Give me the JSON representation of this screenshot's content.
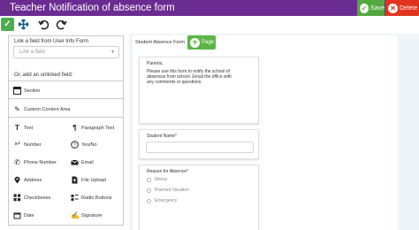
{
  "titlebar": {
    "title": "Teacher Notification of absence form"
  },
  "actions": {
    "save_label": "Save",
    "delete_label": "Delete"
  },
  "left_panel": {
    "link_heading": "Link a field from User Info Form",
    "link_placeholder": "Link a field",
    "unlinked_heading": "Or, add an unlinked field:",
    "section_label": "Section",
    "custom_label": "Custom Content Area",
    "fields": [
      {
        "label": "Text",
        "icon": "text-icon"
      },
      {
        "label": "Paragraph Text",
        "icon": "paragraph-icon"
      },
      {
        "label": "Number",
        "icon": "number-icon"
      },
      {
        "label": "Yes/No",
        "icon": "yes-no-icon"
      },
      {
        "label": "Phone Number",
        "icon": "phone-icon"
      },
      {
        "label": "Email",
        "icon": "email-icon"
      },
      {
        "label": "Address",
        "icon": "map-pin-icon"
      },
      {
        "label": "File Upload",
        "icon": "file-upload-icon"
      },
      {
        "label": "Checkboxes",
        "icon": "checkboxes-icon"
      },
      {
        "label": "Radio Buttons",
        "icon": "radio-buttons-icon"
      },
      {
        "label": "Date",
        "icon": "calendar-icon"
      },
      {
        "label": "Signature",
        "icon": "signature-icon"
      }
    ]
  },
  "canvas": {
    "page_tab": "Student Absence Form",
    "page_button": "Page",
    "intro_lines": [
      "Parents,",
      "",
      "Please use this form to notify the school of",
      "absences from school. Email the office with",
      "any comments or questions."
    ],
    "student_name_label": "Student Name*",
    "reason_label": "Reason for Absence*",
    "reasons": [
      "Illness",
      "Planned Vacation",
      "Emergency"
    ]
  },
  "colors": {
    "titlebar": "#6a2c91",
    "save": "#53a93f",
    "delete": "#e0341f",
    "canvas_bg": "#eef4f8"
  }
}
